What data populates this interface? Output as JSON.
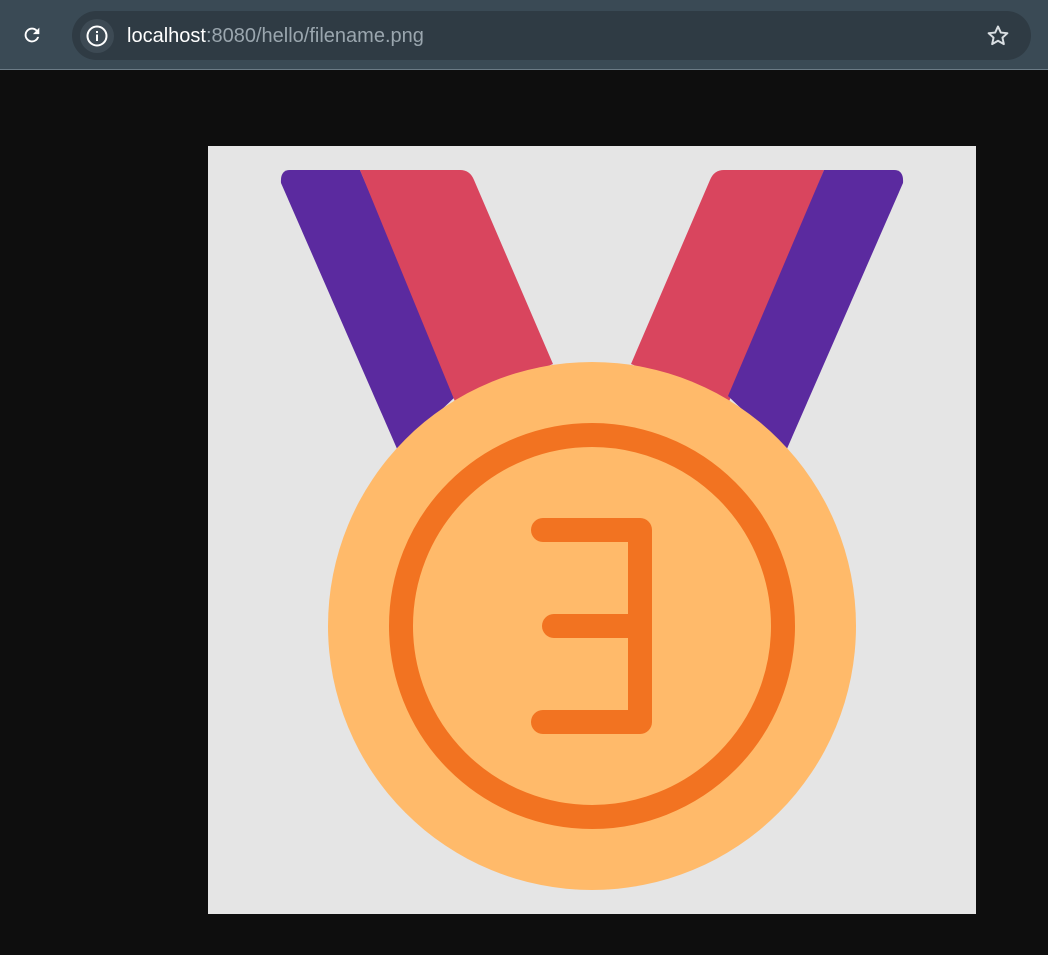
{
  "browser": {
    "url_host": "localhost",
    "url_rest": ":8080/hello/filename.png",
    "icons": {
      "reload": "reload-icon",
      "site_info": "info-icon",
      "bookmark": "star-icon"
    }
  },
  "image": {
    "description_icon": "medal-icon",
    "numeral": "3",
    "colors": {
      "background": "#e5e5e5",
      "ribbon_purple": "#5b2a9f",
      "ribbon_red": "#d9455e",
      "medal_outer": "#ffba6a",
      "medal_ring": "#f27321",
      "page_background": "#0e0e0e"
    }
  }
}
